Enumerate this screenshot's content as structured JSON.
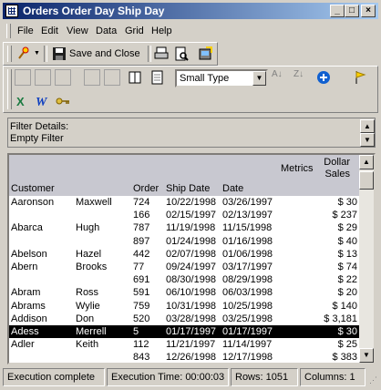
{
  "window": {
    "title": "Orders Order Day Ship Day"
  },
  "menu": [
    "File",
    "Edit",
    "View",
    "Data",
    "Grid",
    "Help"
  ],
  "toolbar": {
    "save_close_label": "Save and Close",
    "font_combo_value": "Small Type"
  },
  "filter": {
    "heading": "Filter Details:",
    "value": "Empty Filter"
  },
  "grid": {
    "headers": {
      "customer": "Customer",
      "order": "Order",
      "ship_date": "Ship Date",
      "date": "Date",
      "metrics": "Metrics",
      "dollar_l1": "Dollar",
      "dollar_l2": "Sales"
    },
    "rows": [
      {
        "last": "Aaronson",
        "first": "Maxwell",
        "order": "724",
        "ship": "10/22/1998",
        "date": "03/26/1997",
        "sales": "$ 30"
      },
      {
        "last": "",
        "first": "",
        "order": "166",
        "ship": "02/15/1997",
        "date": "02/13/1997",
        "sales": "$ 237"
      },
      {
        "last": "Abarca",
        "first": "Hugh",
        "order": "787",
        "ship": "11/19/1998",
        "date": "11/15/1998",
        "sales": "$ 29"
      },
      {
        "last": "",
        "first": "",
        "order": "897",
        "ship": "01/24/1998",
        "date": "01/16/1998",
        "sales": "$ 40"
      },
      {
        "last": "Abelson",
        "first": "Hazel",
        "order": "442",
        "ship": "02/07/1998",
        "date": "01/06/1998",
        "sales": "$ 13"
      },
      {
        "last": "Abern",
        "first": "Brooks",
        "order": "77",
        "ship": "09/24/1997",
        "date": "03/17/1997",
        "sales": "$ 74"
      },
      {
        "last": "",
        "first": "",
        "order": "691",
        "ship": "08/30/1998",
        "date": "08/29/1998",
        "sales": "$ 22"
      },
      {
        "last": "Abram",
        "first": "Ross",
        "order": "591",
        "ship": "06/10/1998",
        "date": "06/03/1998",
        "sales": "$ 20"
      },
      {
        "last": "Abrams",
        "first": "Wylie",
        "order": "759",
        "ship": "10/31/1998",
        "date": "10/25/1998",
        "sales": "$ 140"
      },
      {
        "last": "Addison",
        "first": "Don",
        "order": "520",
        "ship": "03/28/1998",
        "date": "03/25/1998",
        "sales": "$ 3,181"
      },
      {
        "last": "Adess",
        "first": "Merrell",
        "order": "5",
        "ship": "01/17/1997",
        "date": "01/17/1997",
        "sales": "$ 30"
      },
      {
        "last": "Adler",
        "first": "Keith",
        "order": "112",
        "ship": "11/21/1997",
        "date": "11/14/1997",
        "sales": "$ 25"
      },
      {
        "last": "",
        "first": "",
        "order": "843",
        "ship": "12/26/1998",
        "date": "12/17/1998",
        "sales": "$ 383"
      }
    ],
    "selected_row_index": 10
  },
  "status": {
    "message": "Execution complete",
    "time": "Execution Time: 00:00:03",
    "rows": "Rows: 1051",
    "columns": "Columns: 1"
  },
  "colors": {
    "titlebar_start": "#0a246a",
    "titlebar_end": "#a6caf0",
    "face": "#d4d0c8",
    "selection": "#000000"
  }
}
